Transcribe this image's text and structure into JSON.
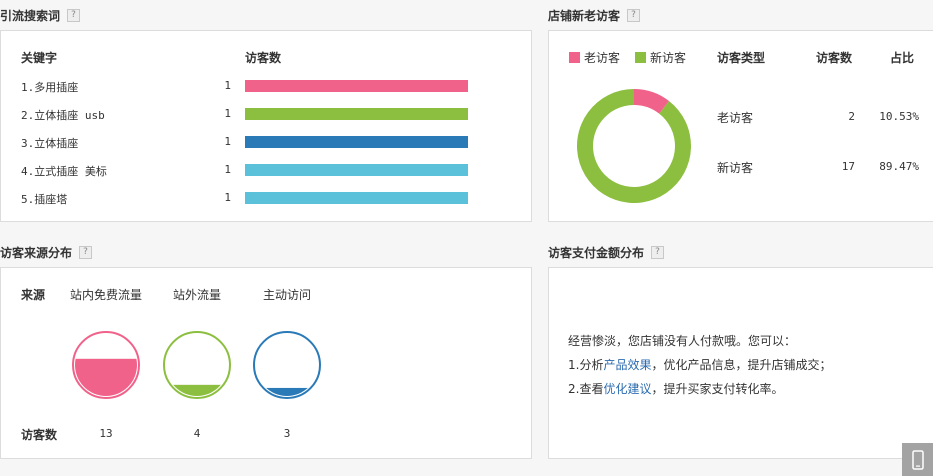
{
  "keywords": {
    "title": "引流搜索词",
    "help": "?",
    "col_keyword": "关键字",
    "col_visitors": "访客数",
    "rows": [
      {
        "name": "1.多用插座",
        "count": "1",
        "color": "#f0628a",
        "fill": 1.0
      },
      {
        "name": "2.立体插座 usb",
        "count": "1",
        "color": "#8cbf3f",
        "fill": 1.0
      },
      {
        "name": "3.立体插座",
        "count": "1",
        "color": "#2a7ab8",
        "fill": 1.0
      },
      {
        "name": "4.立式插座 美标",
        "count": "1",
        "color": "#5bc0da",
        "fill": 1.0
      },
      {
        "name": "5.插座塔",
        "count": "1",
        "color": "#5bc0da",
        "fill": 1.0
      }
    ]
  },
  "new_old": {
    "title": "店铺新老访客",
    "help": "?",
    "legend_old": "老访客",
    "legend_new": "新访客",
    "col_type": "访客类型",
    "col_visitors": "访客数",
    "col_ratio": "占比",
    "rows": [
      {
        "type": "老访客",
        "count": "2",
        "ratio": "10.53%"
      },
      {
        "type": "新访客",
        "count": "17",
        "ratio": "89.47%"
      }
    ],
    "color_old": "#f0628a",
    "color_new": "#8cbf3f",
    "old_fraction": 0.1053
  },
  "sources": {
    "title": "访客来源分布",
    "help": "?",
    "row_label_source": "来源",
    "row_label_visitors": "访客数",
    "items": [
      {
        "name": "站内免费流量",
        "count": "13",
        "color": "#f0628a",
        "fill": 0.6
      },
      {
        "name": "站外流量",
        "count": "4",
        "color": "#8cbf3f",
        "fill": 0.18
      },
      {
        "name": "主动访问",
        "count": "3",
        "color": "#2a7ab8",
        "fill": 0.13
      }
    ]
  },
  "payment": {
    "title": "访客支付金额分布",
    "help": "?",
    "line1": "经营惨淡，您店铺没有人付款哦。您可以：",
    "line2_pre": "1.分析",
    "line2_link": "产品效果",
    "line2_post": "，优化产品信息，提升店铺成交；",
    "line3_pre": "2.查看",
    "line3_link": "优化建议",
    "line3_post": "，提升买家支付转化率。"
  }
}
